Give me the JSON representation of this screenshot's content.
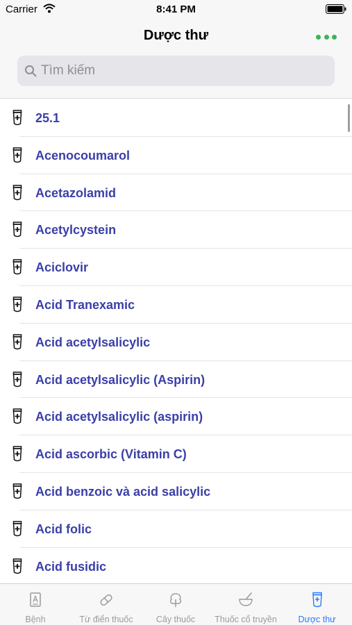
{
  "status_bar": {
    "carrier": "Carrier",
    "time": "8:41 PM"
  },
  "nav": {
    "title": "Dược thư",
    "more_icon": "more-dots-icon",
    "accent_color": "#3cb55a"
  },
  "search": {
    "placeholder": "Tìm kiếm",
    "value": ""
  },
  "list": {
    "item_icon": "drug-tube-icon",
    "item_color": "#3a3fa8",
    "items": [
      "25.1",
      "Acenocoumarol",
      "Acetazolamid",
      "Acetylcystein",
      "Aciclovir",
      "Acid Tranexamic",
      "Acid acetylsalicylic",
      "Acid acetylsalicylic (Aspirin)",
      "Acid acetylsalicylic (aspirin)",
      "Acid ascorbic (Vitamin C)",
      "Acid benzoic và acid salicylic",
      "Acid folic",
      "Acid fusidic"
    ]
  },
  "tab_bar": {
    "active_color": "#2979ff",
    "tabs": [
      {
        "label": "Bệnh",
        "icon": "disease-icon"
      },
      {
        "label": "Từ điển thuốc",
        "icon": "pill-icon"
      },
      {
        "label": "Cây thuốc",
        "icon": "tree-icon"
      },
      {
        "label": "Thuốc cổ truyền",
        "icon": "mortar-icon"
      },
      {
        "label": "Dược thư",
        "icon": "drug-tube-icon",
        "active": true
      }
    ]
  }
}
